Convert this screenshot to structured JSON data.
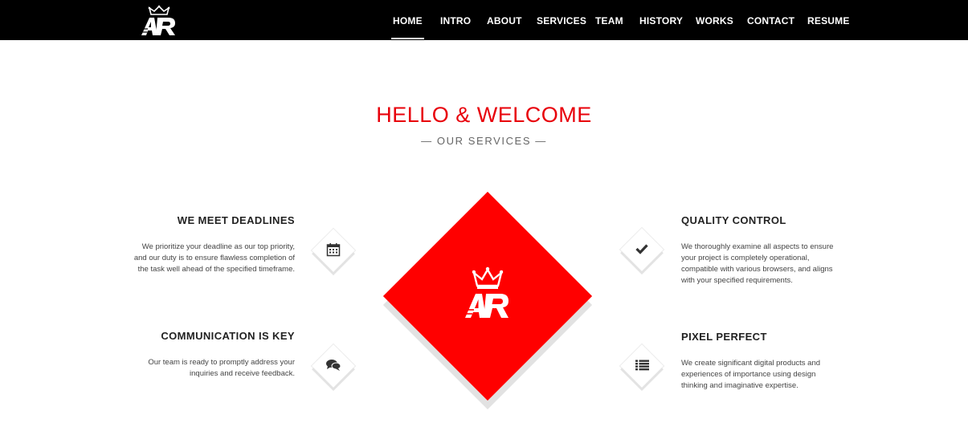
{
  "brand": {
    "logo_text": "AR"
  },
  "nav": {
    "items": [
      {
        "label": "HOME",
        "active": true
      },
      {
        "label": "INTRO"
      },
      {
        "label": "ABOUT"
      },
      {
        "label": "SERVICES"
      },
      {
        "label": "TEAM"
      },
      {
        "label": "HISTORY"
      },
      {
        "label": "WORKS"
      },
      {
        "label": "CONTACT"
      },
      {
        "label": "RESUME"
      }
    ]
  },
  "section": {
    "title": "HELLO & WELCOME",
    "subtitle": "— OUR SERVICES —"
  },
  "services": [
    {
      "title": "WE MEET DEADLINES",
      "lines": [
        "We prioritize your deadline as our top priority,",
        "and our duty is to ensure flawless completion of",
        "the task well ahead of the specified timeframe."
      ],
      "icon": "calendar-icon"
    },
    {
      "title": "COMMUNICATION IS KEY",
      "lines": [
        "Our team is ready to promptly address your",
        "inquiries and receive feedback."
      ],
      "icon": "chat-icon"
    },
    {
      "title": "QUALITY CONTROL",
      "lines": [
        "We thoroughly examine all aspects to ensure",
        "your project is completely operational,",
        "compatible with various browsers, and aligns",
        "with your specified requirements."
      ],
      "icon": "checkmark-icon"
    },
    {
      "title": "PIXEL PERFECT",
      "lines": [
        "We create significant digital products and",
        "experiences of importance using design",
        "thinking and imaginative expertise."
      ],
      "icon": "list-icon"
    }
  ],
  "colors": {
    "accent": "#ff0000",
    "heading_red": "#e8000a",
    "navbar": "#000000"
  }
}
